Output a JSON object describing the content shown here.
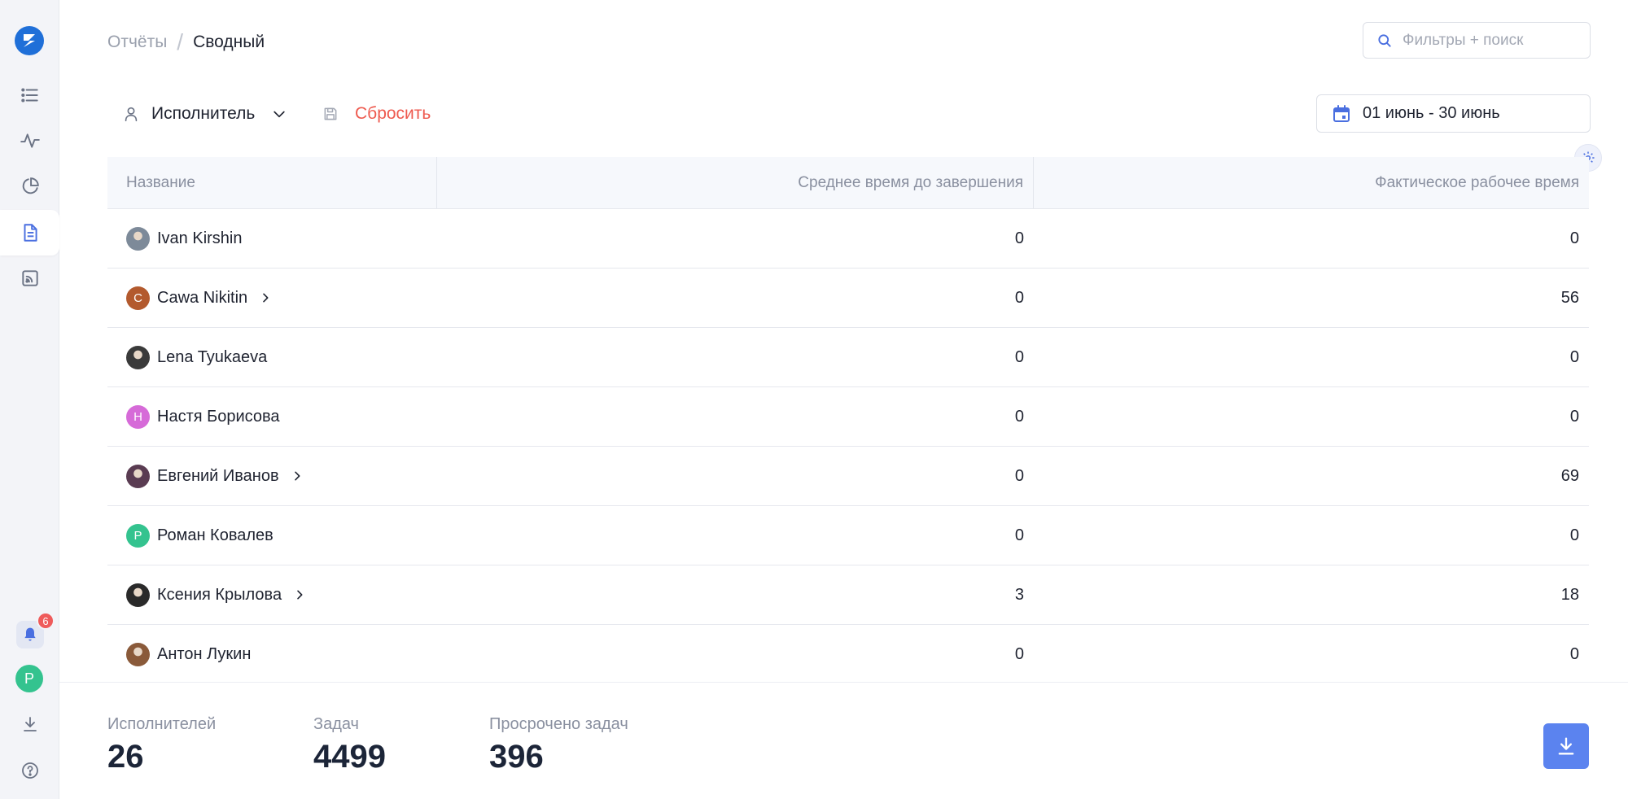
{
  "colors": {
    "accent": "#5b83ef",
    "reset": "#ee5a4f",
    "logo": "#1f6fd8",
    "badge": "#ef5b5b"
  },
  "sidebar": {
    "logo_icon": "logo-s",
    "items": [
      {
        "name": "list-icon"
      },
      {
        "name": "activity-icon"
      },
      {
        "name": "pie-chart-icon"
      },
      {
        "name": "document-icon",
        "active": true
      },
      {
        "name": "feed-icon"
      }
    ],
    "notifications_count": "6",
    "user_initial": "Р"
  },
  "breadcrumb": {
    "parent": "Отчёты",
    "current": "Сводный"
  },
  "search": {
    "placeholder": "Фильтры + поиск",
    "value": ""
  },
  "toolbar": {
    "group_by_label": "Исполнитель",
    "reset_label": "Сбросить",
    "date_range": "01 июнь - 30 июнь"
  },
  "table": {
    "columns": [
      "Название",
      "Среднее время до завершения",
      "Фактическое рабочее время"
    ],
    "rows": [
      {
        "name": "Ivan Kirshin",
        "avatar_type": "photo",
        "avatar_color": "#7d8a99",
        "avg": "0",
        "actual": "0",
        "expandable": false
      },
      {
        "name": "Cawa Nikitin",
        "avatar_type": "initial",
        "initial": "C",
        "avatar_color": "#b35a2e",
        "avg": "0",
        "actual": "56",
        "expandable": true
      },
      {
        "name": "Lena Tyukaeva",
        "avatar_type": "photo",
        "avatar_color": "#3a3a3a",
        "avg": "0",
        "actual": "0",
        "expandable": false
      },
      {
        "name": "Настя Борисова",
        "avatar_type": "initial",
        "initial": "Н",
        "avatar_color": "#d66bd8",
        "avg": "0",
        "actual": "0",
        "expandable": false
      },
      {
        "name": "Евгений Иванов",
        "avatar_type": "photo",
        "avatar_color": "#5a3c52",
        "avg": "0",
        "actual": "69",
        "expandable": true
      },
      {
        "name": "Роман Ковалев",
        "avatar_type": "initial",
        "initial": "Р",
        "avatar_color": "#34c38f",
        "avg": "0",
        "actual": "0",
        "expandable": false
      },
      {
        "name": "Ксения Крылова",
        "avatar_type": "photo",
        "avatar_color": "#2a2a2a",
        "avg": "3",
        "actual": "18",
        "expandable": true
      },
      {
        "name": "Антон Лукин",
        "avatar_type": "photo",
        "avatar_color": "#8a5a3a",
        "avg": "0",
        "actual": "0",
        "expandable": false
      }
    ]
  },
  "stats": [
    {
      "label": "Исполнителей",
      "value": "26"
    },
    {
      "label": "Задач",
      "value": "4499"
    },
    {
      "label": "Просрочено задач",
      "value": "396"
    }
  ]
}
